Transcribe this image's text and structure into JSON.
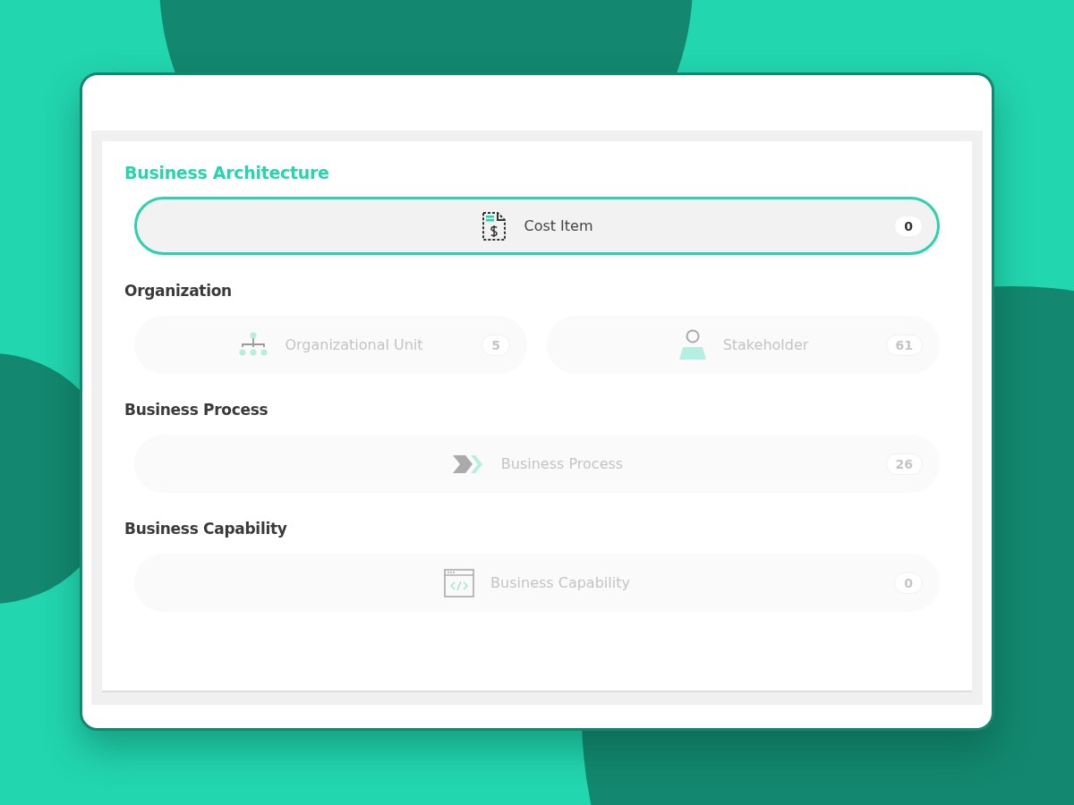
{
  "title": "Business Architecture",
  "groups": [
    {
      "items": [
        {
          "kind": "cost",
          "label": "Cost Item",
          "count": "0",
          "selected": true
        }
      ]
    },
    {
      "heading": "Organization",
      "items": [
        {
          "kind": "org",
          "label": "Organizational Unit",
          "count": "5",
          "selected": false
        },
        {
          "kind": "person",
          "label": "Stakeholder",
          "count": "61",
          "selected": false
        }
      ]
    },
    {
      "heading": "Business Process",
      "items": [
        {
          "kind": "process",
          "label": "Business Process",
          "count": "26",
          "selected": false
        }
      ]
    },
    {
      "heading": "Business Capability",
      "items": [
        {
          "kind": "capability",
          "label": "Business Capability",
          "count": "0",
          "selected": false
        }
      ]
    }
  ]
}
